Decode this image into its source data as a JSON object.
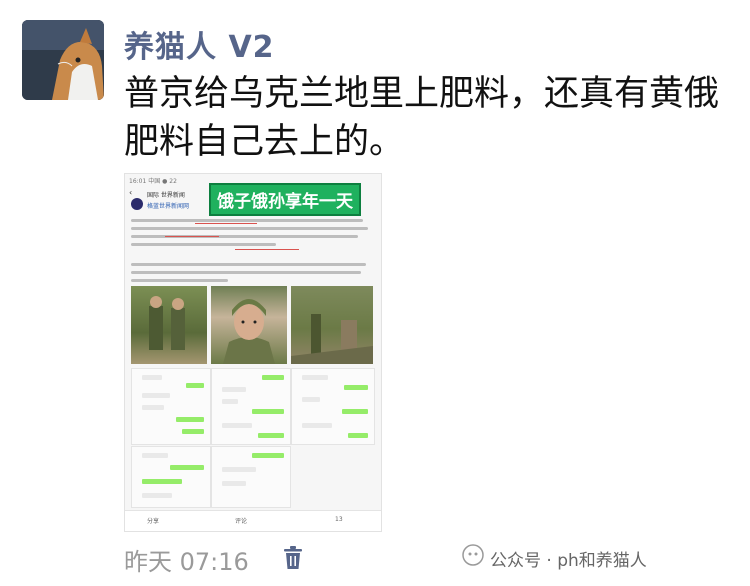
{
  "post": {
    "author": "养猫人 V2",
    "text": "普京给乌克兰地里上肥料，还真有黄俄肥料自己去上的。",
    "time": "昨天 07:16"
  },
  "embedded": {
    "header": "16:01 中国 ● 22",
    "nav_title": "国际 世界新闻",
    "account": "格蓝世界新闻网",
    "overlay_tag": "饿子饿孙享年一天",
    "bottom_counts": [
      "分享",
      "评论",
      "13"
    ]
  },
  "watermark": "公众号 · ph和养猫人"
}
